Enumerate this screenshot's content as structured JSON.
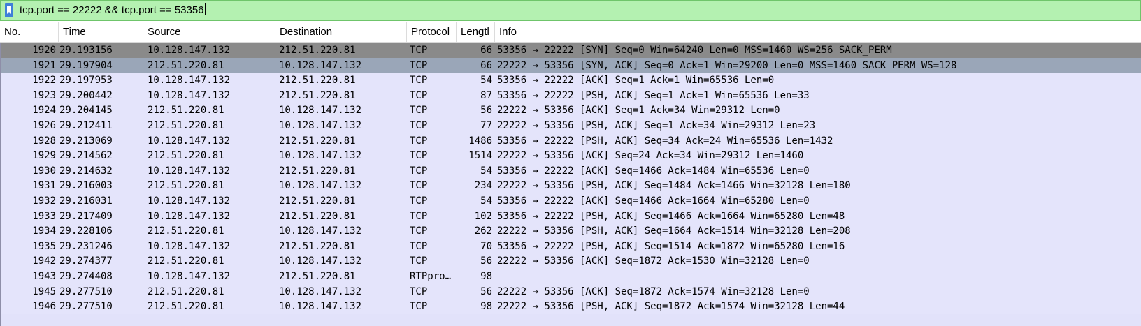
{
  "filter": {
    "text": "tcp.port == 22222 && tcp.port == 53356"
  },
  "columns": [
    "No.",
    "Time",
    "Source",
    "Destination",
    "Protocol",
    "Lengtl",
    "Info"
  ],
  "packets": [
    {
      "no": "1920",
      "time": "29.193156",
      "src": "10.128.147.132",
      "dst": "212.51.220.81",
      "proto": "TCP",
      "len": "66",
      "info": "53356 → 22222 [SYN] Seq=0 Win=64240 Len=0 MSS=1460 WS=256 SACK_PERM"
    },
    {
      "no": "1921",
      "time": "29.197904",
      "src": "212.51.220.81",
      "dst": "10.128.147.132",
      "proto": "TCP",
      "len": "66",
      "info": "22222 → 53356 [SYN, ACK] Seq=0 Ack=1 Win=29200 Len=0 MSS=1460 SACK_PERM WS=128"
    },
    {
      "no": "1922",
      "time": "29.197953",
      "src": "10.128.147.132",
      "dst": "212.51.220.81",
      "proto": "TCP",
      "len": "54",
      "info": "53356 → 22222 [ACK] Seq=1 Ack=1 Win=65536 Len=0"
    },
    {
      "no": "1923",
      "time": "29.200442",
      "src": "10.128.147.132",
      "dst": "212.51.220.81",
      "proto": "TCP",
      "len": "87",
      "info": "53356 → 22222 [PSH, ACK] Seq=1 Ack=1 Win=65536 Len=33"
    },
    {
      "no": "1924",
      "time": "29.204145",
      "src": "212.51.220.81",
      "dst": "10.128.147.132",
      "proto": "TCP",
      "len": "56",
      "info": "22222 → 53356 [ACK] Seq=1 Ack=34 Win=29312 Len=0"
    },
    {
      "no": "1926",
      "time": "29.212411",
      "src": "212.51.220.81",
      "dst": "10.128.147.132",
      "proto": "TCP",
      "len": "77",
      "info": "22222 → 53356 [PSH, ACK] Seq=1 Ack=34 Win=29312 Len=23"
    },
    {
      "no": "1928",
      "time": "29.213069",
      "src": "10.128.147.132",
      "dst": "212.51.220.81",
      "proto": "TCP",
      "len": "1486",
      "info": "53356 → 22222 [PSH, ACK] Seq=34 Ack=24 Win=65536 Len=1432"
    },
    {
      "no": "1929",
      "time": "29.214562",
      "src": "212.51.220.81",
      "dst": "10.128.147.132",
      "proto": "TCP",
      "len": "1514",
      "info": "22222 → 53356 [ACK] Seq=24 Ack=34 Win=29312 Len=1460"
    },
    {
      "no": "1930",
      "time": "29.214632",
      "src": "10.128.147.132",
      "dst": "212.51.220.81",
      "proto": "TCP",
      "len": "54",
      "info": "53356 → 22222 [ACK] Seq=1466 Ack=1484 Win=65536 Len=0"
    },
    {
      "no": "1931",
      "time": "29.216003",
      "src": "212.51.220.81",
      "dst": "10.128.147.132",
      "proto": "TCP",
      "len": "234",
      "info": "22222 → 53356 [PSH, ACK] Seq=1484 Ack=1466 Win=32128 Len=180"
    },
    {
      "no": "1932",
      "time": "29.216031",
      "src": "10.128.147.132",
      "dst": "212.51.220.81",
      "proto": "TCP",
      "len": "54",
      "info": "53356 → 22222 [ACK] Seq=1466 Ack=1664 Win=65280 Len=0"
    },
    {
      "no": "1933",
      "time": "29.217409",
      "src": "10.128.147.132",
      "dst": "212.51.220.81",
      "proto": "TCP",
      "len": "102",
      "info": "53356 → 22222 [PSH, ACK] Seq=1466 Ack=1664 Win=65280 Len=48"
    },
    {
      "no": "1934",
      "time": "29.228106",
      "src": "212.51.220.81",
      "dst": "10.128.147.132",
      "proto": "TCP",
      "len": "262",
      "info": "22222 → 53356 [PSH, ACK] Seq=1664 Ack=1514 Win=32128 Len=208"
    },
    {
      "no": "1935",
      "time": "29.231246",
      "src": "10.128.147.132",
      "dst": "212.51.220.81",
      "proto": "TCP",
      "len": "70",
      "info": "53356 → 22222 [PSH, ACK] Seq=1514 Ack=1872 Win=65280 Len=16"
    },
    {
      "no": "1942",
      "time": "29.274377",
      "src": "212.51.220.81",
      "dst": "10.128.147.132",
      "proto": "TCP",
      "len": "56",
      "info": "22222 → 53356 [ACK] Seq=1872 Ack=1530 Win=32128 Len=0"
    },
    {
      "no": "1943",
      "time": "29.274408",
      "src": "10.128.147.132",
      "dst": "212.51.220.81",
      "proto": "RTPpro…",
      "len": "98",
      "info": ""
    },
    {
      "no": "1945",
      "time": "29.277510",
      "src": "212.51.220.81",
      "dst": "10.128.147.132",
      "proto": "TCP",
      "len": "56",
      "info": "22222 → 53356 [ACK] Seq=1872 Ack=1574 Win=32128 Len=0"
    },
    {
      "no": "1946",
      "time": "29.277510",
      "src": "212.51.220.81",
      "dst": "10.128.147.132",
      "proto": "TCP",
      "len": "98",
      "info": "22222 → 53356 [PSH, ACK] Seq=1872 Ack=1574 Win=32128 Len=44"
    }
  ],
  "icons": {
    "filter_bookmark": "bookmark-icon"
  },
  "colors": {
    "filter_valid_bg": "#b4f1b1",
    "row_bg": "#e4e4fb",
    "selected_row": "#8a8a8a",
    "related_row": "#9aa6b8"
  }
}
